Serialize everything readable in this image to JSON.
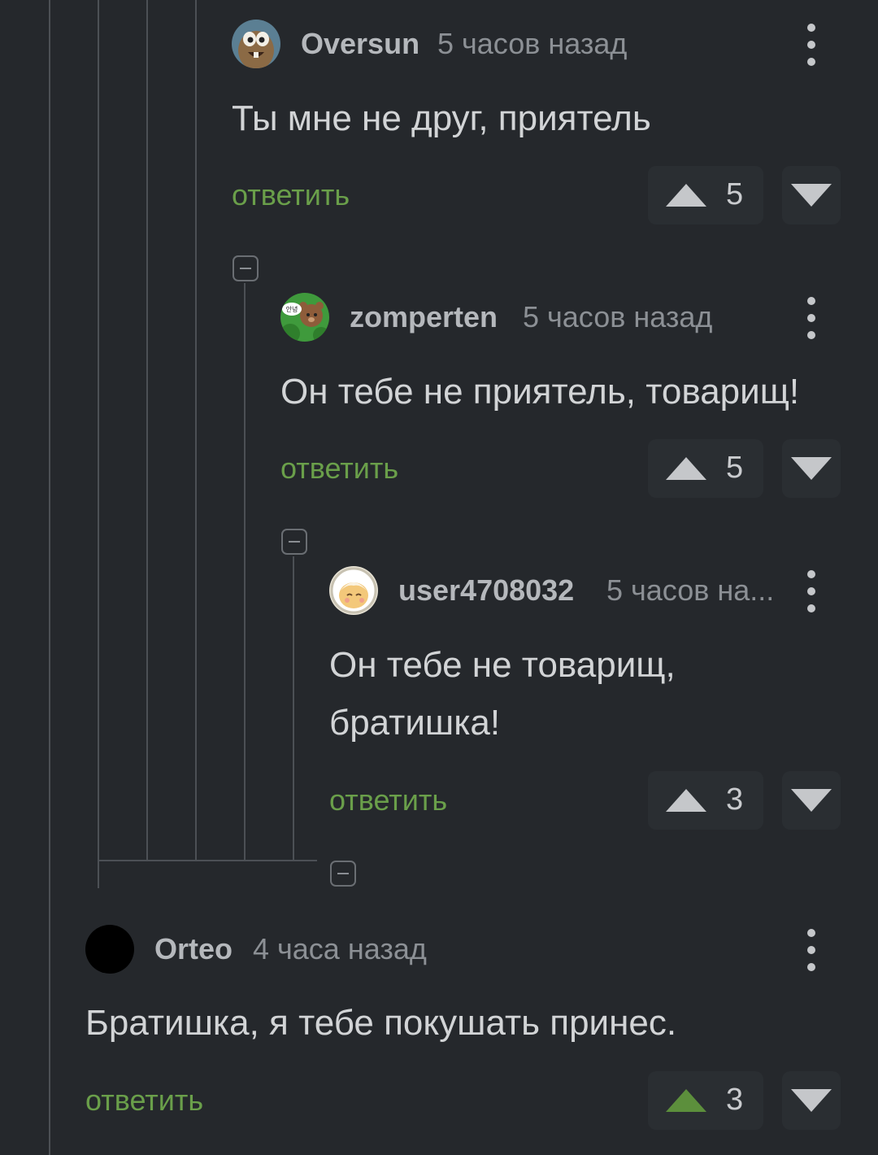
{
  "comments": [
    {
      "username": "Oversun",
      "time": "5 часов назад",
      "text": "Ты мне не друг, приятель",
      "reply_label": "ответить",
      "votes": "5",
      "upvoted": false
    },
    {
      "username": "zomperten",
      "time": "5 часов назад",
      "text": "Он тебе не приятель, товарищ!",
      "reply_label": "ответить",
      "votes": "5",
      "upvoted": false
    },
    {
      "username": "user4708032",
      "time": "5 часов на...",
      "text_line1": "Он тебе не товарищ,",
      "text_line2": "братишка!",
      "reply_label": "ответить",
      "votes": "3",
      "upvoted": false
    },
    {
      "username": "Orteo",
      "time": "4 часа назад",
      "text": "Братишка, я тебе покушать принес.",
      "reply_label": "ответить",
      "votes": "3",
      "upvoted": true
    }
  ],
  "avatar_texts": {
    "zomperten_bubble": "안녕"
  },
  "colors": {
    "background": "#25282c",
    "reply_link": "#6a9f4a",
    "upvote_active": "#5c8f3c",
    "vote_inactive": "#c5c7ca",
    "thread_line": "#4c5055"
  },
  "icons": {
    "upvote": "triangle-up-icon",
    "downvote": "triangle-down-icon",
    "more": "vertical-ellipsis-icon",
    "collapse": "minus-square-icon"
  }
}
